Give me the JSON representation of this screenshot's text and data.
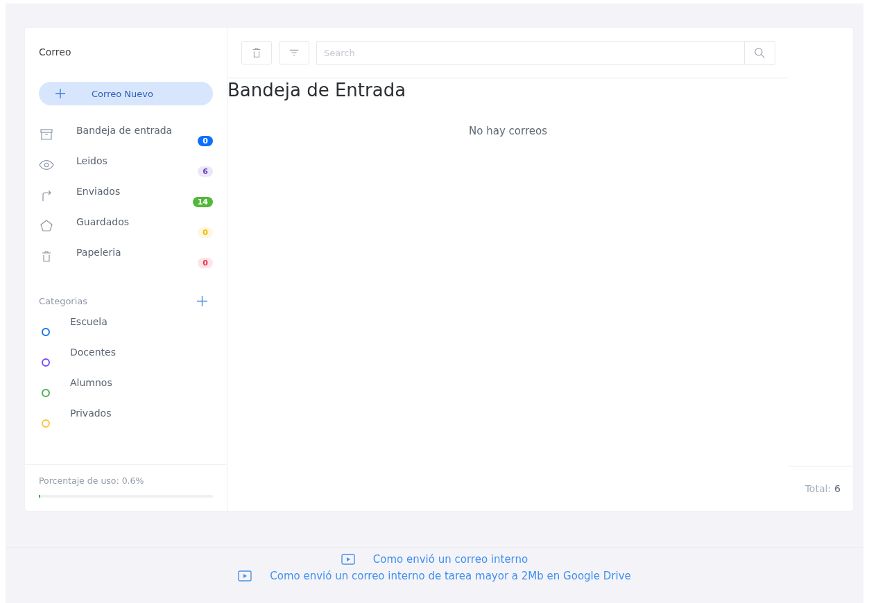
{
  "sidebar": {
    "title": "Correo",
    "new_button": "Correo Nuevo",
    "folders": [
      {
        "kind": "inbox",
        "label": "Bandeja de entrada",
        "count": "0",
        "color": "#0d6efd",
        "filled": true
      },
      {
        "kind": "read",
        "label": "Leidos",
        "count": "6",
        "color": "#6f42c1",
        "filled": false
      },
      {
        "kind": "sent",
        "label": "Enviados",
        "count": "14",
        "color": "#52b83a",
        "filled": true
      },
      {
        "kind": "saved",
        "label": "Guardados",
        "count": "0",
        "color": "#f5b800",
        "filled": false
      },
      {
        "kind": "trash",
        "label": "Papeleria",
        "count": "0",
        "color": "#e8384f",
        "filled": false
      }
    ],
    "categories_title": "Categorias",
    "categories": [
      {
        "label": "Escuela",
        "color": "#1a73e8"
      },
      {
        "label": "Docentes",
        "color": "#7c4dff"
      },
      {
        "label": "Alumnos",
        "color": "#4caf50"
      },
      {
        "label": "Privados",
        "color": "#ffc13d"
      }
    ],
    "usage": {
      "label": "Porcentaje de uso: 0.6%",
      "level": 0.006
    }
  },
  "toolbar": {
    "search": {
      "placeholder": "Search"
    }
  },
  "main": {
    "title": "Bandeja de Entrada",
    "empty_message": "No hay correos"
  },
  "total": {
    "label": "Total:",
    "value": "6"
  },
  "footer_links": [
    "Como envió un correo interno",
    "Como envió un correo interno de tarea mayor a 2Mb en Google Drive"
  ]
}
